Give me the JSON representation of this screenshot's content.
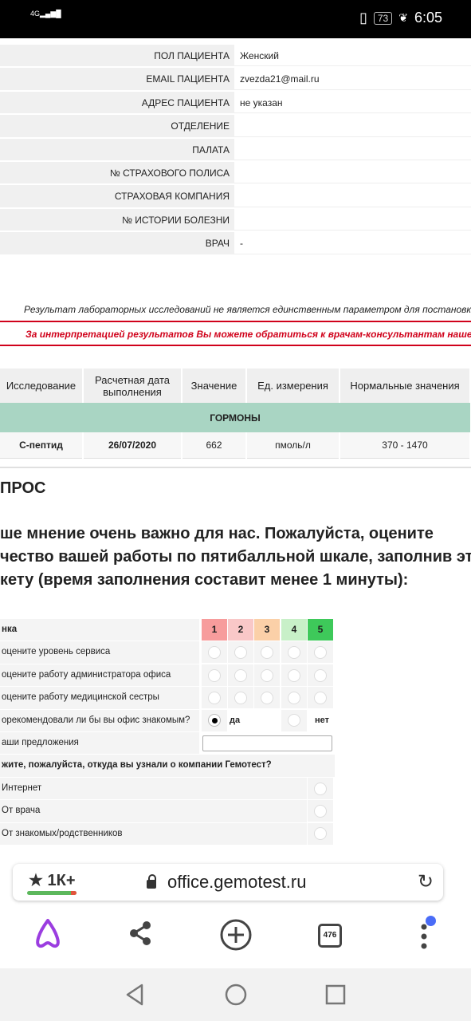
{
  "status_bar": {
    "network": "4G",
    "battery": "73",
    "time": "6:05"
  },
  "patient": [
    {
      "label": "ПОЛ ПАЦИЕНТА",
      "value": "Женский"
    },
    {
      "label": "EMAIL ПАЦИЕНТА",
      "value": "zvezda21@mail.ru"
    },
    {
      "label": "АДРЕС ПАЦИЕНТА",
      "value": "не указан"
    },
    {
      "label": "ОТДЕЛЕНИЕ",
      "value": ""
    },
    {
      "label": "ПАЛАТА",
      "value": ""
    },
    {
      "label": "№ СТРАХОВОГО ПОЛИСА",
      "value": ""
    },
    {
      "label": "СТРАХОВАЯ КОМПАНИЯ",
      "value": ""
    },
    {
      "label": "№ ИСТОРИИ БОЛЕЗНИ",
      "value": ""
    },
    {
      "label": "ВРАЧ",
      "value": "-"
    }
  ],
  "disclaimer": "Результат лабораторных исследований не является единственным параметром для постановки диагноза",
  "warning": "За интерпретацией результатов Вы можете обратиться к врачам-консультантам нашего контакт-центра",
  "results": {
    "headers": [
      "Исследование",
      "Расчетная дата выполнения",
      "Значение",
      "Ед. измерения",
      "Нормальные значения"
    ],
    "group": "ГОРМОНЫ",
    "rows": [
      [
        "С-пептид",
        "26/07/2020",
        "662",
        "пмоль/л",
        "370 - 1470"
      ]
    ]
  },
  "survey": {
    "title": "ПРОС",
    "intro_lines": [
      "ше мнение очень важно для нас. Пожалуйста, оцените",
      "чество вашей работы по пятибалльной шкале, заполнив эт",
      "кету (время заполнения составит менее 1 минуты):"
    ],
    "rating_header": "нка",
    "scale": [
      "1",
      "2",
      "3",
      "4",
      "5"
    ],
    "scale_colors": [
      "#f79c9c",
      "#f9c8c8",
      "#fbd0a8",
      "#c8f0c8",
      "#3ec95a"
    ],
    "questions": [
      "оцените уровень сервиса",
      "оцените работу администратора офиса",
      "оцените работу медицинской сестры"
    ],
    "recommend_q": "орекомендовали ли бы вы офис знакомым?",
    "yes": "да",
    "no": "нет",
    "suggestions": "аши предложения",
    "source_q": "жите, пожалуйста, откуда вы узнали о компании Гемотест?",
    "sources": [
      "Интернет",
      "От врача",
      "От знакомых/родственников"
    ]
  },
  "browser": {
    "rating": "1К+",
    "url": "office.gemotest.ru",
    "tabs": "476"
  }
}
